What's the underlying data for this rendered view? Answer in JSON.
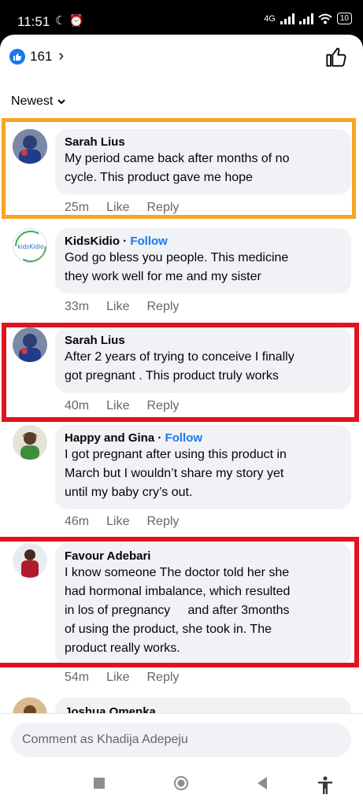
{
  "status_bar": {
    "time": "11:51",
    "network": "4G",
    "battery": "10"
  },
  "reactions": {
    "count": "161",
    "chevron": "›"
  },
  "sort": {
    "label": "Newest"
  },
  "comments": [
    {
      "author": "Sarah Lius",
      "follow": "",
      "lines": [
        "My period came back after months of no",
        "cycle. This product gave me hope"
      ],
      "time": "25m",
      "like": "Like",
      "reply": "Reply"
    },
    {
      "author": "KidsKidio",
      "follow": "Follow",
      "lines": [
        "God go bless you people. This medicine",
        "they work well for me and my sister"
      ],
      "time": "33m",
      "like": "Like",
      "reply": "Reply"
    },
    {
      "author": "Sarah Lius",
      "follow": "",
      "lines": [
        "After 2 years of trying to conceive I finally",
        "got pregnant . This product truly works"
      ],
      "time": "40m",
      "like": "Like",
      "reply": "Reply"
    },
    {
      "author": "Happy and Gina",
      "follow": "Follow",
      "lines": [
        "I got pregnant after using this product in",
        "March but I wouldn’t share my story yet",
        "until my baby cry’s out."
      ],
      "time": "46m",
      "like": "Like",
      "reply": "Reply"
    },
    {
      "author": "Favour Adebari",
      "follow": "",
      "lines": [
        "I know someone The doctor told her she",
        "had hormonal imbalance, which resulted",
        "in los of pregnancy     and after 3months",
        "of using the product, she took in. The",
        "product really works."
      ],
      "time": "54m",
      "like": "Like",
      "reply": "Reply"
    },
    {
      "author": "Joshua Omenka"
    }
  ],
  "avatar_logo_text": "kidsKidio",
  "composer": {
    "placeholder": "Comment as Khadija Adepeju"
  },
  "colors": {
    "accent": "#1877f2",
    "bubble": "#f0f2f5",
    "highlight_orange": "#f5a623",
    "highlight_red": "#e0141e"
  }
}
